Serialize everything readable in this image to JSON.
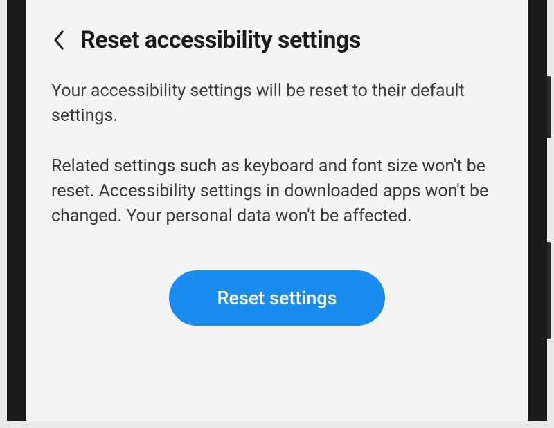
{
  "header": {
    "title": "Reset accessibility settings"
  },
  "content": {
    "description": "Your accessibility settings will be reset to their default settings.",
    "details": "Related settings such as keyboard and font size won't be reset. Accessibility settings in downloaded apps won't be changed. Your personal data won't be affected."
  },
  "actions": {
    "reset_label": "Reset settings"
  },
  "colors": {
    "accent": "#1a8cf0",
    "background": "#f5f5f5",
    "text_primary": "#1a1a1a",
    "text_body": "#3a3a3a"
  }
}
